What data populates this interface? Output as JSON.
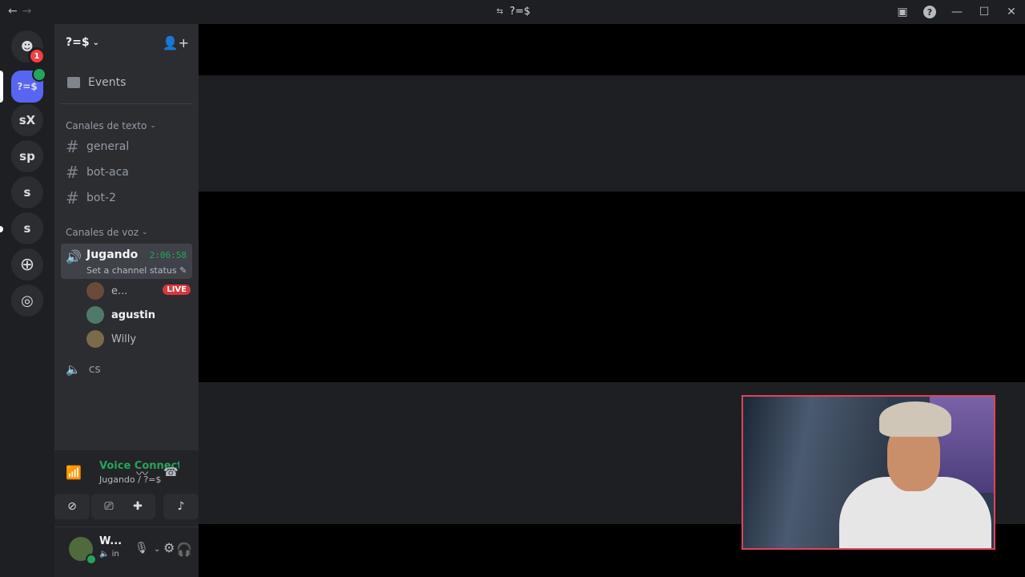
{
  "window": {
    "title": "?=$",
    "title_icon": "link-icon"
  },
  "guilds": [
    {
      "label": "",
      "icon": "discord-icon",
      "badge": "1"
    },
    {
      "label": "?=$",
      "active": true
    },
    {
      "label": "sX"
    },
    {
      "label": "sp"
    },
    {
      "label": "s"
    },
    {
      "label": "s"
    },
    {
      "label": "",
      "icon": "add-server-icon"
    },
    {
      "label": "",
      "icon": "discover-icon"
    }
  ],
  "server": {
    "name": "?=$",
    "events_label": "Events",
    "text_category": "Canales de texto",
    "text_channels": [
      "general",
      "bot-aca",
      "bot-2"
    ],
    "voice_category": "Canales de voz",
    "voice_channel": {
      "name": "Jugando",
      "timer": "2:06:58",
      "status": "Set a channel status"
    },
    "voice_users": [
      {
        "name": "e...",
        "live": "LIVE"
      },
      {
        "name": "agustin"
      },
      {
        "name": "Willy"
      }
    ],
    "other_voice_channel": "cs"
  },
  "voice_connected": {
    "title": "Voice Connected",
    "subtitle": "Jugando / ?=$"
  },
  "user": {
    "name": "W...",
    "status": "in"
  }
}
